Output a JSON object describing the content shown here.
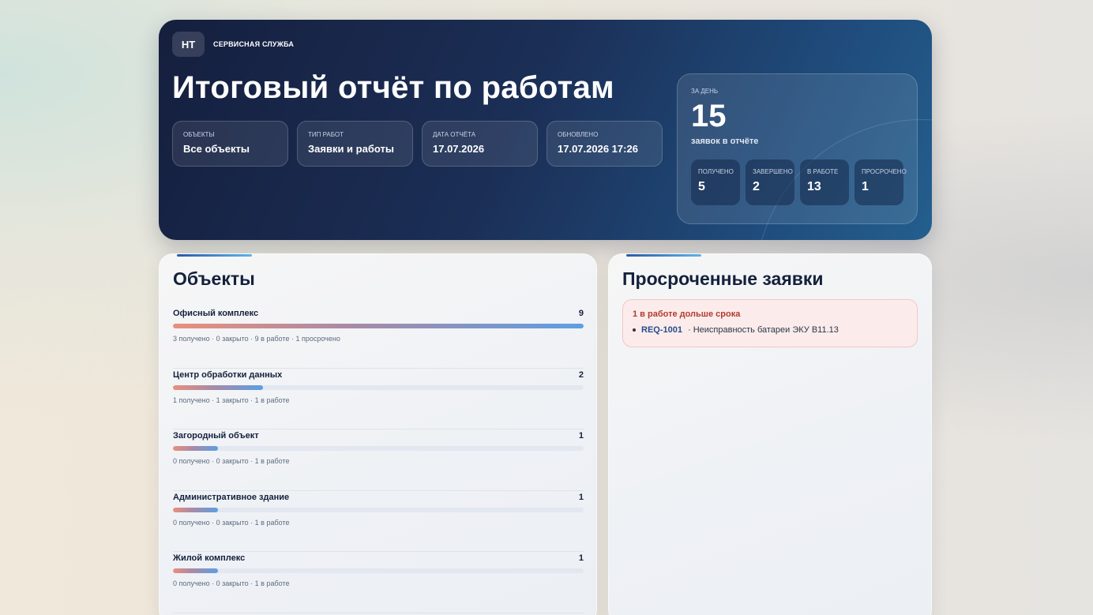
{
  "brand": {
    "logo": "НТ",
    "name": "СЕРВИСНАЯ СЛУЖБА"
  },
  "hero": {
    "title": "Итоговый отчёт по работам",
    "meta": [
      {
        "label": "ОБЪЕКТЫ",
        "value": "Все объекты"
      },
      {
        "label": "ТИП РАБОТ",
        "value": "Заявки и работы"
      },
      {
        "label": "ДАТА ОТЧЁТА",
        "value": "17.07.2026"
      },
      {
        "label": "ОБНОВЛЕНО",
        "value": "17.07.2026 17:26"
      }
    ]
  },
  "day": {
    "label": "ЗА ДЕНЬ",
    "count": "15",
    "caption": "заявок в отчёте",
    "stats": [
      {
        "label": "ПОЛУЧЕНО",
        "value": "5"
      },
      {
        "label": "ЗАВЕРШЕНО",
        "value": "2"
      },
      {
        "label": "В РАБОТЕ",
        "value": "13"
      },
      {
        "label": "ПРОСРОЧЕНО",
        "value": "1"
      }
    ]
  },
  "objects": {
    "title": "Объекты",
    "items": [
      {
        "name": "Офисный комплекс",
        "count": "9",
        "share": 1.0,
        "summary": "3 получено · 0 закрыто · 9 в работе · 1 просрочено"
      },
      {
        "name": "Центр обработки данных",
        "count": "2",
        "share": 0.22,
        "summary": "1 получено · 1 закрыто · 1 в работе"
      },
      {
        "name": "Загородный объект",
        "count": "1",
        "share": 0.11,
        "summary": "0 получено · 0 закрыто · 1 в работе"
      },
      {
        "name": "Административное здание",
        "count": "1",
        "share": 0.11,
        "summary": "0 получено · 0 закрыто · 1 в работе"
      },
      {
        "name": "Жилой комплекс",
        "count": "1",
        "share": 0.11,
        "summary": "0 получено · 0 закрыто · 1 в работе"
      }
    ]
  },
  "overdue": {
    "title": "Просроченные заявки",
    "alert_title": "1 в работе дольше срока",
    "items": [
      {
        "id": "REQ-1001",
        "text": "· Неисправность батареи ЭКУ В11.13"
      }
    ]
  }
}
